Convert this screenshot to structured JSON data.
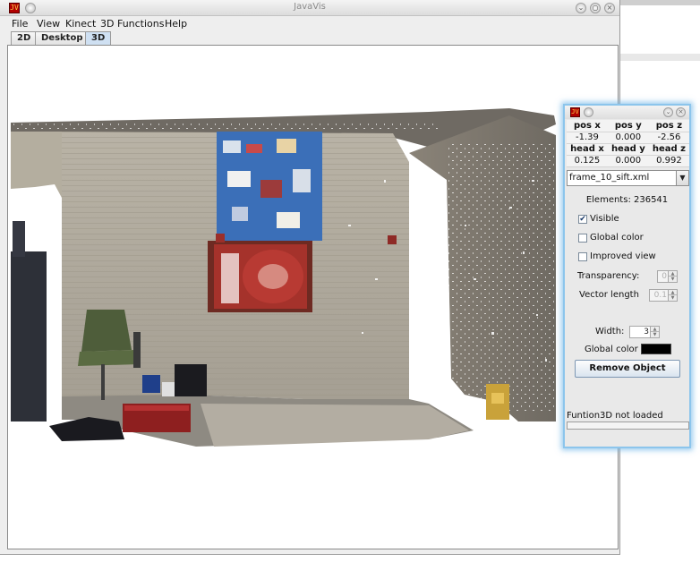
{
  "window": {
    "title": "JavaVis",
    "app_icon": "javavis-app-icon",
    "controls": [
      "minimize-icon",
      "maximize-icon",
      "close-icon"
    ]
  },
  "menubar": {
    "items": [
      "File",
      "View",
      "Kinect",
      "3D Functions",
      "Help"
    ]
  },
  "tabs": [
    {
      "label": "2D",
      "active": false
    },
    {
      "label": "Desktop",
      "active": false
    },
    {
      "label": "3D",
      "active": true
    }
  ],
  "viewport": {
    "content": "3d-point-cloud-scene"
  },
  "panel": {
    "pose_headers": [
      "pos x",
      "pos y",
      "pos z"
    ],
    "pose_values": [
      "-1.39",
      "0.000",
      "-2.56"
    ],
    "head_headers": [
      "head x",
      "head y",
      "head z"
    ],
    "head_values": [
      "0.125",
      "0.000",
      "0.992"
    ],
    "object_select": "frame_10_sift.xml",
    "elements_label": "Elements: 236541",
    "visible": {
      "label": "Visible",
      "checked": true
    },
    "global_color_check": {
      "label": "Global color",
      "checked": false
    },
    "improved_view": {
      "label": "Improved view",
      "checked": false
    },
    "transparency": {
      "label": "Transparency:",
      "value": "0",
      "enabled": false
    },
    "vector_length": {
      "label": "Vector length",
      "value": "0.1",
      "enabled": false
    },
    "width": {
      "label": "Width:",
      "value": "3",
      "enabled": true
    },
    "global_color": {
      "label": "Global color",
      "color": "#000000"
    },
    "remove_button": "Remove Object",
    "status": "Funtion3D not loaded"
  },
  "colors": {
    "panel_border": "#8cc5ec",
    "active_tab": "#cfe0f2",
    "app_icon_red": "#b10000"
  }
}
